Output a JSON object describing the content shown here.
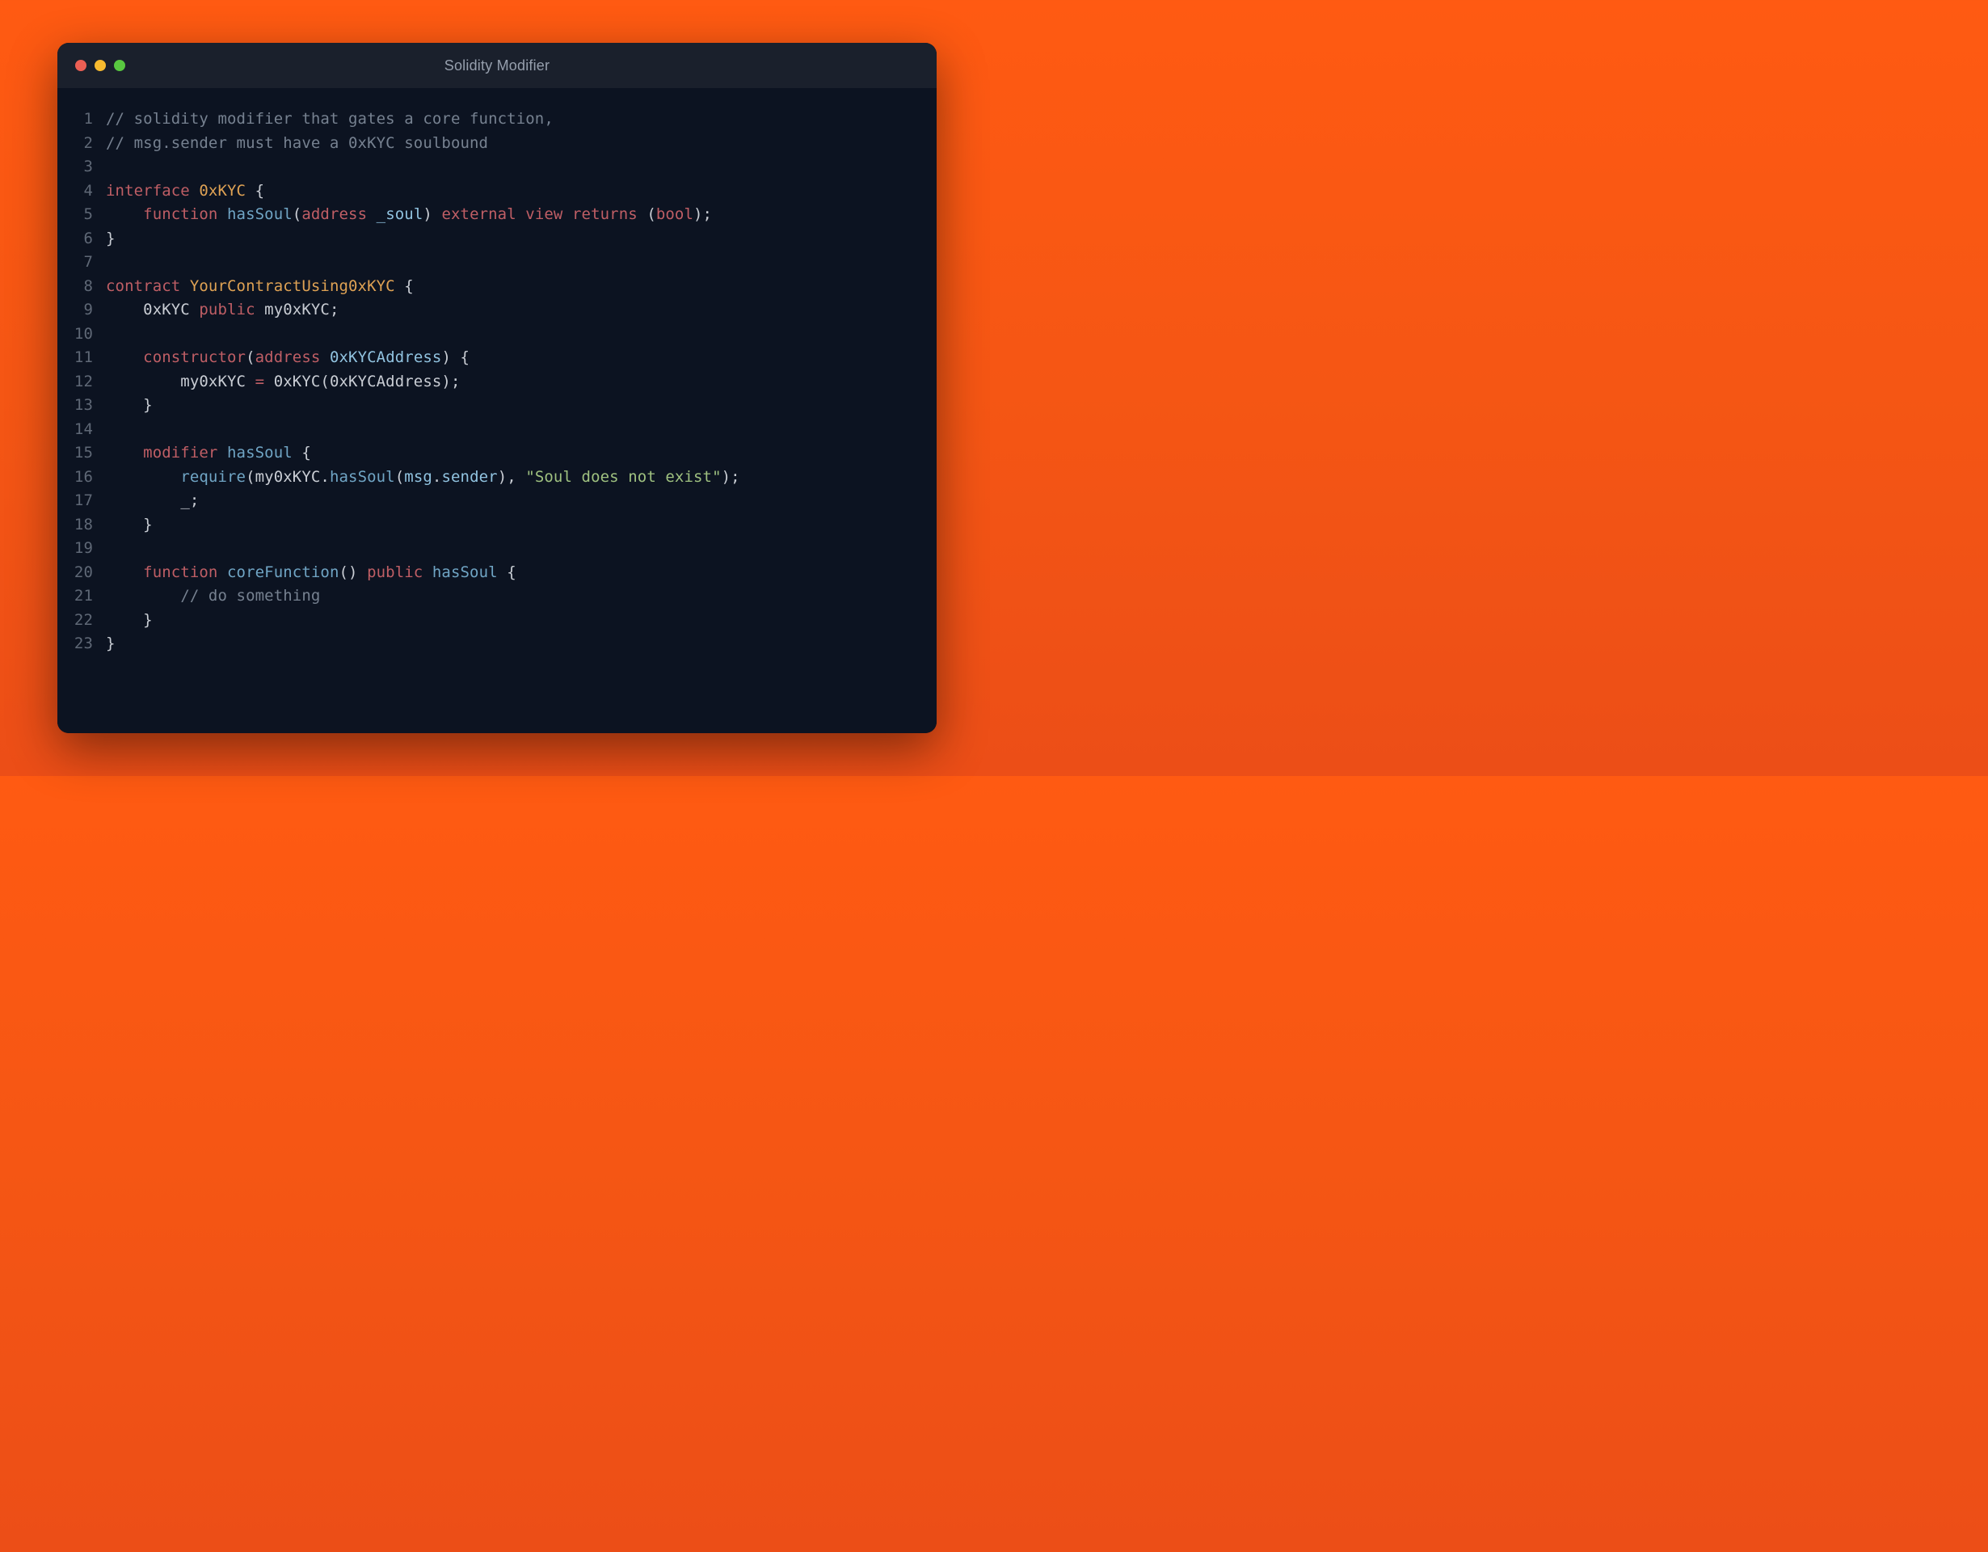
{
  "window": {
    "title": "Solidity Modifier"
  },
  "code": {
    "line_numbers": [
      "1",
      "2",
      "3",
      "4",
      "5",
      "6",
      "7",
      "8",
      "9",
      "10",
      "11",
      "12",
      "13",
      "14",
      "15",
      "16",
      "17",
      "18",
      "19",
      "20",
      "21",
      "22",
      "23"
    ],
    "lines": [
      [
        [
          "c",
          "// solidity modifier that gates a core function,"
        ]
      ],
      [
        [
          "c",
          "// msg.sender must have a 0xKYC soulbound"
        ]
      ],
      [],
      [
        [
          "k",
          "interface "
        ],
        [
          "t",
          "0xKYC"
        ],
        [
          "pu",
          " {"
        ]
      ],
      [
        [
          "pu",
          "    "
        ],
        [
          "k",
          "function "
        ],
        [
          "f",
          "hasSoul"
        ],
        [
          "pu",
          "("
        ],
        [
          "k",
          "address"
        ],
        [
          "pu",
          " "
        ],
        [
          "p",
          "_soul"
        ],
        [
          "pu",
          ") "
        ],
        [
          "k",
          "external view returns"
        ],
        [
          "pu",
          " ("
        ],
        [
          "k",
          "bool"
        ],
        [
          "pu",
          ");"
        ]
      ],
      [
        [
          "pu",
          "}"
        ]
      ],
      [],
      [
        [
          "k",
          "contract "
        ],
        [
          "t",
          "YourContractUsing0xKYC"
        ],
        [
          "pu",
          " {"
        ]
      ],
      [
        [
          "pu",
          "    0xKYC "
        ],
        [
          "k",
          "public"
        ],
        [
          "pu",
          " "
        ],
        [
          "v",
          "my0xKYC"
        ],
        [
          "pu",
          ";"
        ]
      ],
      [],
      [
        [
          "pu",
          "    "
        ],
        [
          "k",
          "constructor"
        ],
        [
          "pu",
          "("
        ],
        [
          "k",
          "address"
        ],
        [
          "pu",
          " "
        ],
        [
          "p",
          "0xKYCAddress"
        ],
        [
          "pu",
          ") {"
        ]
      ],
      [
        [
          "pu",
          "        my0xKYC "
        ],
        [
          "k",
          "="
        ],
        [
          "pu",
          " 0xKYC(0xKYCAddress);"
        ]
      ],
      [
        [
          "pu",
          "    }"
        ]
      ],
      [],
      [
        [
          "pu",
          "    "
        ],
        [
          "k",
          "modifier "
        ],
        [
          "f",
          "hasSoul"
        ],
        [
          "pu",
          " {"
        ]
      ],
      [
        [
          "pu",
          "        "
        ],
        [
          "f",
          "require"
        ],
        [
          "pu",
          "(my0xKYC."
        ],
        [
          "f",
          "hasSoul"
        ],
        [
          "pu",
          "("
        ],
        [
          "p",
          "msg"
        ],
        [
          "pu",
          "."
        ],
        [
          "p",
          "sender"
        ],
        [
          "pu",
          "), "
        ],
        [
          "s",
          "\"Soul does not exist\""
        ],
        [
          "pu",
          ");"
        ]
      ],
      [
        [
          "pu",
          "        "
        ],
        [
          "v",
          "_"
        ],
        [
          "pu",
          ";"
        ]
      ],
      [
        [
          "pu",
          "    }"
        ]
      ],
      [],
      [
        [
          "pu",
          "    "
        ],
        [
          "k",
          "function "
        ],
        [
          "f",
          "coreFunction"
        ],
        [
          "pu",
          "() "
        ],
        [
          "k",
          "public"
        ],
        [
          "pu",
          " "
        ],
        [
          "f",
          "hasSoul"
        ],
        [
          "pu",
          " {"
        ]
      ],
      [
        [
          "pu",
          "        "
        ],
        [
          "c",
          "// do something"
        ]
      ],
      [
        [
          "pu",
          "    }"
        ]
      ],
      [
        [
          "pu",
          "}"
        ]
      ]
    ]
  }
}
